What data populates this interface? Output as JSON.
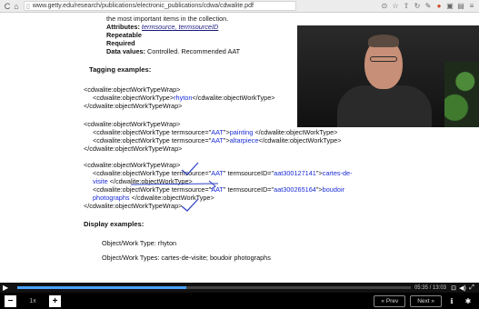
{
  "browser": {
    "url": "www.getty.edu/research/publications/electronic_publications/cdwa/cdwalite.pdf",
    "icons": [
      "back-icon",
      "refresh-icon",
      "page-icon",
      "star-icon",
      "bookmark-icon",
      "extension-icon",
      "menu-icon"
    ]
  },
  "document": {
    "lead_text": "the most important items in the collection.",
    "attributes_label": "Attributes:",
    "attributes_values": "termsource, termsourceID",
    "repeatable": "Repeatable",
    "required": "Required",
    "data_values_label": "Data values:",
    "data_values_text": "Controlled. Recommended AAT",
    "tagging_heading": "Tagging examples:",
    "code": {
      "ex1_open": "<cdwalite:objectWorkTypeWrap>",
      "ex1_line_a": "<cdwalite:objectWorkType>",
      "ex1_val": "rhyton",
      "ex1_line_b": "</cdwalite:objectWorkType>",
      "ex1_close": "</cdwalite:objectWorkTypeWrap>",
      "ex2_open": "<cdwalite:objectWorkTypeWrap>",
      "ex2_l1_a": "<cdwalite:objectWorkType termsource=\"",
      "ex2_l1_src": "AAT",
      "ex2_l1_b": "\">",
      "ex2_l1_val": "painting",
      "ex2_l1_c": " </cdwalite:objectWorkType>",
      "ex2_l2_a": "<cdwalite:objectWorkType termsource=\"",
      "ex2_l2_src": "AAT",
      "ex2_l2_b": "\">",
      "ex2_l2_val": "altarpiece",
      "ex2_l2_c": "</cdwalite:objectWorkType>",
      "ex2_close": "</cdwalite:objectWorkTypeWrap>",
      "ex3_open": "<cdwalite:objectWorkTypeWrap>",
      "ex3_l1_a": "<cdwalite:objectWorkType termsource=\"",
      "ex3_l1_src": "AAT",
      "ex3_l1_b": "\" termsourceID=\"",
      "ex3_l1_id": "aat300127141",
      "ex3_l1_c": "\">",
      "ex3_l1_val": "cartes-de-",
      "ex3_l1_val2": "visite",
      "ex3_l1_d": " </cdwalite:objectWorkType>",
      "ex3_l2_a": "<cdwalite:objectWorkType termsource=\"",
      "ex3_l2_src": "AAT",
      "ex3_l2_b": "\" termsourceID=\"",
      "ex3_l2_id": "aat300265164",
      "ex3_l2_c": "\">",
      "ex3_l2_val": "boudoir",
      "ex3_l2_val2": "photographs",
      "ex3_l2_d": " </cdwalite:objectWorkType>",
      "ex3_close": "</cdwalite:objectWorkTypeWrap>"
    },
    "display_heading": "Display examples:",
    "display_1": "Object/Work Type: rhyton",
    "display_2": "Object/Work Types: cartes-de-visite; boudoir photographs"
  },
  "player": {
    "time": "05:35 / 13:03",
    "progress": 0.43,
    "buffered": 0.38,
    "speed": "1x",
    "minus_label": "−",
    "plus_label": "+",
    "prev_label": "« Prev",
    "next_label": "Next »",
    "colors": {
      "progress": "#4aa3ff",
      "buffer": "#8c8c8c"
    }
  }
}
